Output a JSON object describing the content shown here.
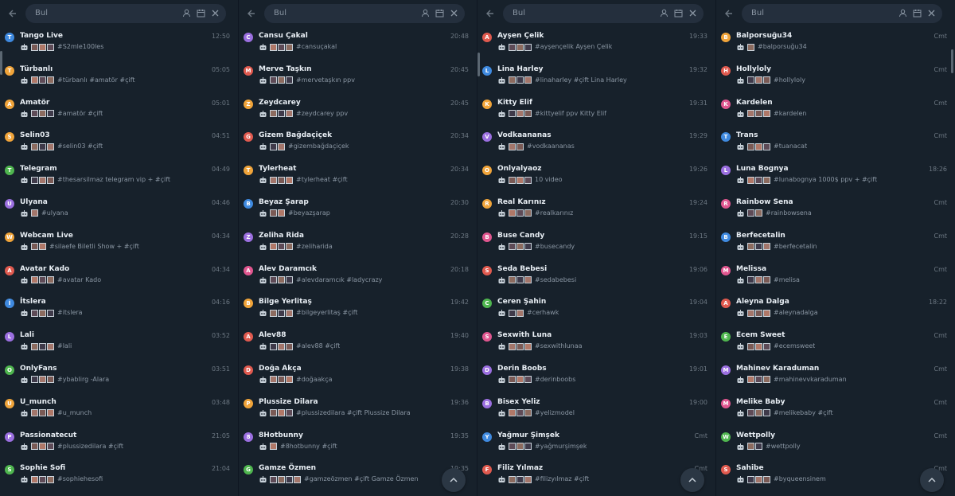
{
  "search": {
    "placeholder": "Bul"
  },
  "colors": {
    "red": "#e05a4f",
    "orange": "#f0a43a",
    "violet": "#9b6fe0",
    "green": "#4fb64f",
    "cyan": "#3fa6d8",
    "blue": "#3f8ae0",
    "pink": "#e0568f"
  },
  "icons": {
    "back": "arrow-left-icon",
    "contact": "person-icon",
    "calendar": "calendar-icon",
    "close": "close-icon",
    "scroll": "chevron-up-icon",
    "bot": "robot-icon"
  },
  "panels": [
    {
      "items": [
        {
          "initial": "T",
          "color": "blue",
          "name": "Tango Live",
          "time": "12:50",
          "thumbs": 3,
          "snippet": "#S2mle100les"
        },
        {
          "initial": "T",
          "color": "orange",
          "name": "Türbanlı",
          "time": "05:05",
          "thumbs": 3,
          "snippet": "#türbanlı #amatör #çift"
        },
        {
          "initial": "A",
          "color": "orange",
          "name": "Amatör",
          "time": "05:01",
          "thumbs": 3,
          "snippet": "#amatör #çift"
        },
        {
          "initial": "S",
          "color": "orange",
          "name": "Selin03",
          "time": "04:51",
          "thumbs": 3,
          "snippet": "#selin03 #çift"
        },
        {
          "initial": "T",
          "color": "green",
          "name": "Telegram",
          "time": "04:49",
          "thumbs": 3,
          "snippet": "#thesarsilmaz telegram vip + #çift"
        },
        {
          "initial": "U",
          "color": "violet",
          "name": "Ulyana",
          "time": "04:46",
          "thumbs": 1,
          "snippet": "#ulyana"
        },
        {
          "initial": "W",
          "color": "orange",
          "name": "Webcam Live",
          "time": "04:34",
          "thumbs": 2,
          "snippet": "#silaefe Biletli Show + #çift"
        },
        {
          "initial": "A",
          "color": "red",
          "name": "Avatar Kado",
          "time": "04:34",
          "thumbs": 3,
          "snippet": "#avatar Kado"
        },
        {
          "initial": "İ",
          "color": "blue",
          "name": "İtslera",
          "time": "04:16",
          "thumbs": 3,
          "snippet": "#itslera"
        },
        {
          "initial": "L",
          "color": "violet",
          "name": "Lali",
          "time": "03:52",
          "thumbs": 3,
          "snippet": "#lali"
        },
        {
          "initial": "O",
          "color": "green",
          "name": "OnlyFans",
          "time": "03:51",
          "thumbs": 3,
          "snippet": "#ybablirg -Alara"
        },
        {
          "initial": "U",
          "color": "orange",
          "name": "U_munch",
          "time": "03:48",
          "thumbs": 3,
          "snippet": "#u_munch"
        },
        {
          "initial": "P",
          "color": "violet",
          "name": "Passionatecut",
          "time": "21:05",
          "thumbs": 3,
          "snippet": "#plussizedilara #çift"
        },
        {
          "initial": "S",
          "color": "green",
          "name": "Sophie Sofi",
          "time": "21:04",
          "thumbs": 3,
          "snippet": "#sophiehesofi"
        }
      ]
    },
    {
      "items": [
        {
          "initial": "C",
          "color": "violet",
          "name": "Cansu Çakal",
          "time": "20:48",
          "thumbs": 3,
          "snippet": "#cansuçakal"
        },
        {
          "initial": "M",
          "color": "red",
          "name": "Merve Taşkın",
          "time": "20:45",
          "thumbs": 3,
          "snippet": "#mervetaşkın ppv"
        },
        {
          "initial": "Z",
          "color": "orange",
          "name": "Zeydcarey",
          "time": "20:45",
          "thumbs": 3,
          "snippet": "#zeydcarey ppv"
        },
        {
          "initial": "G",
          "color": "red",
          "name": "Gizem Bağdaçiçek",
          "time": "20:34",
          "thumbs": 2,
          "snippet": "#gizembağdaçiçek"
        },
        {
          "initial": "T",
          "color": "orange",
          "name": "Tylerheat",
          "time": "20:34",
          "thumbs": 3,
          "snippet": "#tylerheat #çift"
        },
        {
          "initial": "B",
          "color": "blue",
          "name": "Beyaz Şarap",
          "time": "20:30",
          "thumbs": 2,
          "snippet": "#beyazşarap"
        },
        {
          "initial": "Z",
          "color": "violet",
          "name": "Zeliha Rida",
          "time": "20:28",
          "thumbs": 3,
          "snippet": "#zeliharida"
        },
        {
          "initial": "A",
          "color": "pink",
          "name": "Alev Daramcık",
          "time": "20:18",
          "thumbs": 3,
          "snippet": "#alevdaramcık #ladycrazy"
        },
        {
          "initial": "B",
          "color": "orange",
          "name": "Bilge Yerlitaş",
          "time": "19:42",
          "thumbs": 3,
          "snippet": "#bilgeyerlitaş #çift"
        },
        {
          "initial": "A",
          "color": "red",
          "name": "Alev88",
          "time": "19:40",
          "thumbs": 3,
          "snippet": "#alev88 #çift"
        },
        {
          "initial": "D",
          "color": "red",
          "name": "Doğa Akça",
          "time": "19:38",
          "thumbs": 3,
          "snippet": "#doğaakça"
        },
        {
          "initial": "P",
          "color": "orange",
          "name": "Plussize Dilara",
          "time": "19:36",
          "thumbs": 3,
          "snippet": "#plussizedilara #çift Plussize Dilara"
        },
        {
          "initial": "8",
          "color": "violet",
          "name": "8Hotbunny",
          "time": "19:35",
          "thumbs": 1,
          "snippet": "#8hotbunny #çift"
        },
        {
          "initial": "G",
          "color": "green",
          "name": "Gamze Özmen",
          "time": "19:35",
          "thumbs": 4,
          "snippet": "#gamzeözmen #çift Gamze Özmen"
        }
      ]
    },
    {
      "items": [
        {
          "initial": "A",
          "color": "red",
          "name": "Ayşen Çelik",
          "time": "19:33",
          "thumbs": 3,
          "snippet": "#ayşençelik Ayşen Çelik"
        },
        {
          "initial": "L",
          "color": "blue",
          "name": "Lina Harley",
          "time": "19:32",
          "thumbs": 3,
          "snippet": "#linaharley #çift Lina Harley"
        },
        {
          "initial": "K",
          "color": "orange",
          "name": "Kitty Elif",
          "time": "19:31",
          "thumbs": 3,
          "snippet": "#kittyelif ppv Kitty Elif"
        },
        {
          "initial": "V",
          "color": "violet",
          "name": "Vodkaananas",
          "time": "19:29",
          "thumbs": 2,
          "snippet": "#vodkaananas"
        },
        {
          "initial": "O",
          "color": "orange",
          "name": "Onlyalyaoz",
          "time": "19:26",
          "thumbs": 3,
          "snippet": "10 video"
        },
        {
          "initial": "R",
          "color": "orange",
          "name": "Real Karınız",
          "time": "19:24",
          "thumbs": 3,
          "snippet": "#realkarınız"
        },
        {
          "initial": "B",
          "color": "pink",
          "name": "Buse Candy",
          "time": "19:15",
          "thumbs": 3,
          "snippet": "#busecandy"
        },
        {
          "initial": "S",
          "color": "red",
          "name": "Seda Bebesi",
          "time": "19:06",
          "thumbs": 3,
          "snippet": "#sedabebesi"
        },
        {
          "initial": "C",
          "color": "green",
          "name": "Ceren Şahin",
          "time": "19:04",
          "thumbs": 2,
          "snippet": "#cerhawk"
        },
        {
          "initial": "S",
          "color": "pink",
          "name": "Sexwith Luna",
          "time": "19:03",
          "thumbs": 3,
          "snippet": "#sexwithlunaa"
        },
        {
          "initial": "D",
          "color": "violet",
          "name": "Derin Boobs",
          "time": "19:01",
          "thumbs": 3,
          "snippet": "#derinboobs"
        },
        {
          "initial": "B",
          "color": "violet",
          "name": "Bisex Yeliz",
          "time": "19:00",
          "thumbs": 3,
          "snippet": "#yelizmodel"
        },
        {
          "initial": "Y",
          "color": "blue",
          "name": "Yağmur Şimşek",
          "time": "Cmt",
          "thumbs": 3,
          "snippet": "#yağmurşimşek"
        },
        {
          "initial": "F",
          "color": "red",
          "name": "Filiz Yılmaz",
          "time": "Cmt",
          "thumbs": 3,
          "snippet": "#filizyılmaz #çift"
        }
      ]
    },
    {
      "items": [
        {
          "initial": "B",
          "color": "orange",
          "name": "Balporsuğu34",
          "time": "Cmt",
          "thumbs": 1,
          "snippet": "#balporsuğu34"
        },
        {
          "initial": "H",
          "color": "red",
          "name": "Hollyloly",
          "time": "Cmt",
          "thumbs": 3,
          "snippet": "#hollyloly"
        },
        {
          "initial": "K",
          "color": "pink",
          "name": "Kardelen",
          "time": "Cmt",
          "thumbs": 3,
          "snippet": "#kardelen"
        },
        {
          "initial": "T",
          "color": "blue",
          "name": "Trans",
          "time": "Cmt",
          "thumbs": 3,
          "snippet": "#tuanacat"
        },
        {
          "initial": "L",
          "color": "violet",
          "name": "Luna Bognya",
          "time": "18:26",
          "thumbs": 3,
          "snippet": "#lunabognya 1000$ ppv + #çift"
        },
        {
          "initial": "R",
          "color": "pink",
          "name": "Rainbow Sena",
          "time": "Cmt",
          "thumbs": 2,
          "snippet": "#rainbowsena"
        },
        {
          "initial": "B",
          "color": "blue",
          "name": "Berfecetalin",
          "time": "Cmt",
          "thumbs": 3,
          "snippet": "#berfecetalin"
        },
        {
          "initial": "M",
          "color": "pink",
          "name": "Melissa",
          "time": "Cmt",
          "thumbs": 3,
          "snippet": "#melisa"
        },
        {
          "initial": "A",
          "color": "red",
          "name": "Aleyna Dalga",
          "time": "18:22",
          "thumbs": 3,
          "snippet": "#aleynadalga"
        },
        {
          "initial": "E",
          "color": "green",
          "name": "Ecem Sweet",
          "time": "Cmt",
          "thumbs": 3,
          "snippet": "#ecemsweet"
        },
        {
          "initial": "M",
          "color": "violet",
          "name": "Mahinev Karaduman",
          "time": "Cmt",
          "thumbs": 3,
          "snippet": "#mahinevvkaraduman"
        },
        {
          "initial": "M",
          "color": "pink",
          "name": "Melike Baby",
          "time": "Cmt",
          "thumbs": 3,
          "snippet": "#melikebaby #çift"
        },
        {
          "initial": "W",
          "color": "green",
          "name": "Wettpolly",
          "time": "Cmt",
          "thumbs": 2,
          "snippet": "#wettpolly"
        },
        {
          "initial": "S",
          "color": "red",
          "name": "Sahibe",
          "time": "Cmt",
          "thumbs": 3,
          "snippet": "#byqueensinem"
        }
      ]
    }
  ]
}
